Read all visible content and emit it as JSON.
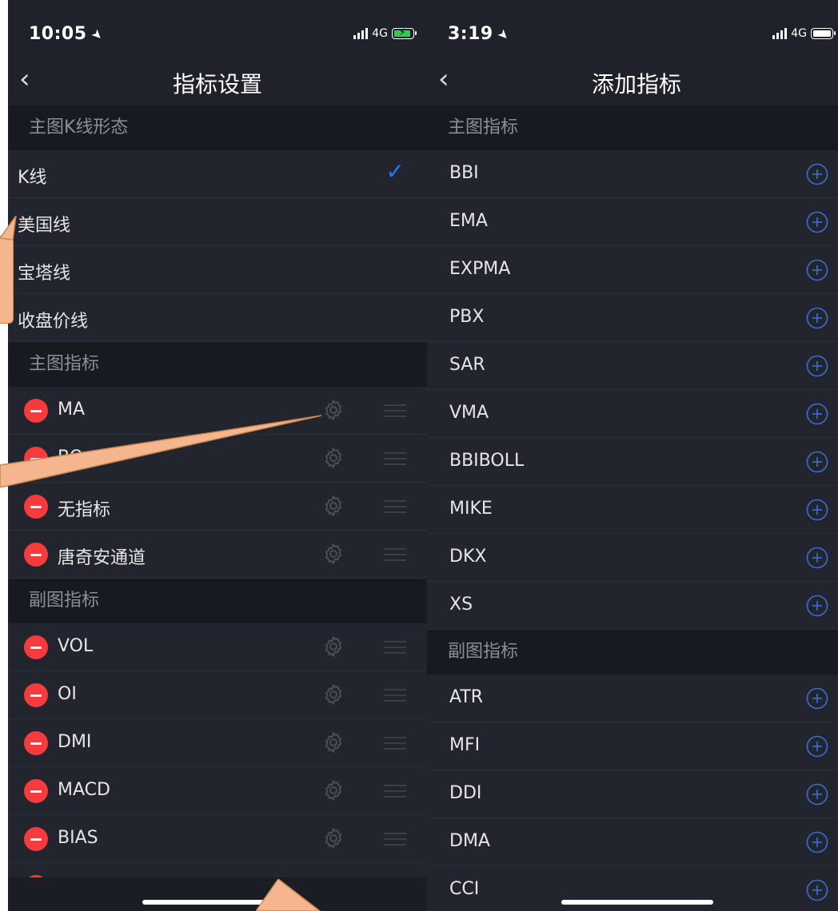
{
  "left_screen": {
    "status_time": "10:05",
    "network": "4G",
    "title": "指标设置",
    "kline_section": "主图K线形态",
    "kline_types": [
      {
        "label": "K线",
        "selected": true
      },
      {
        "label": "美国线",
        "selected": false
      },
      {
        "label": "宝塔线",
        "selected": false
      },
      {
        "label": "收盘价线",
        "selected": false
      }
    ],
    "main_section": "主图指标",
    "main_indicators": [
      "MA",
      "BO",
      "无指标",
      "唐奇安通道"
    ],
    "sub_section": "副图指标",
    "sub_indicators": [
      "VOL",
      "OI",
      "DMI",
      "MACD",
      "BIAS"
    ]
  },
  "right_screen": {
    "status_time": "3:19",
    "network": "4G",
    "title": "添加指标",
    "main_section": "主图指标",
    "main_indicators": [
      "BBI",
      "EMA",
      "EXPMA",
      "PBX",
      "SAR",
      "VMA",
      "BBIBOLL",
      "MIKE",
      "DKX",
      "XS"
    ],
    "sub_section": "副图指标",
    "sub_indicators": [
      "ATR",
      "MFI",
      "DDI",
      "DMA",
      "CCI"
    ]
  },
  "colors": {
    "background": "#1f222a",
    "row": "#22252d",
    "section": "#171a20",
    "accent_blue": "#1f7bff",
    "plus_blue": "#3a6fd8",
    "remove_red": "#f53b3b",
    "callout_orange": "#f5b58e"
  }
}
